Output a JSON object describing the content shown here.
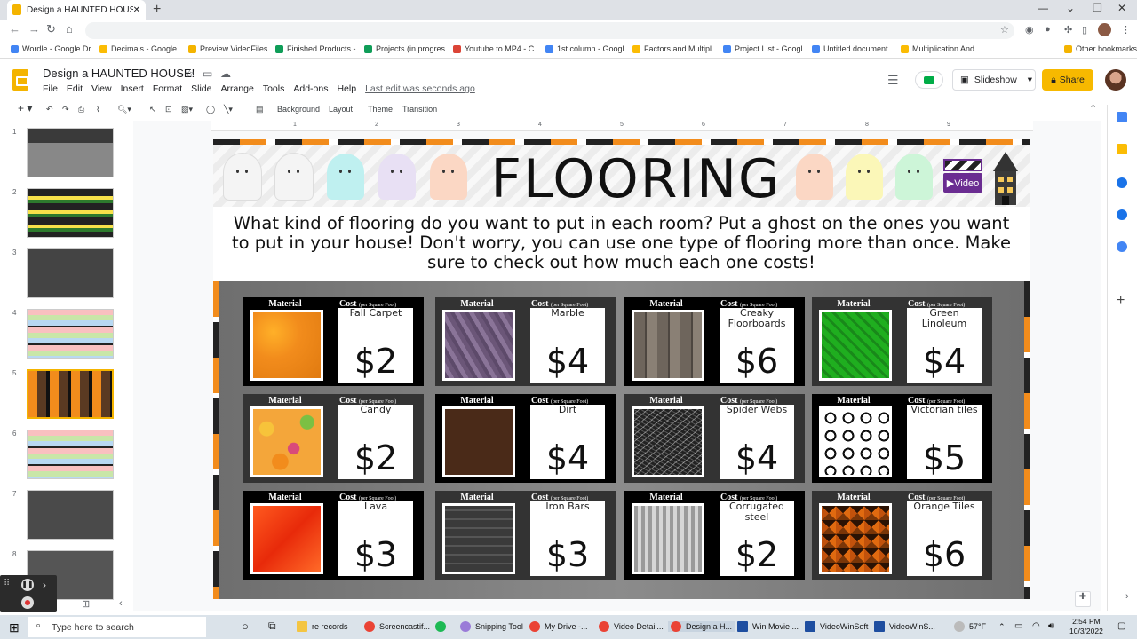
{
  "browser": {
    "tab_title": "Design a HAUNTED HOUSE! - Go",
    "close": "✕",
    "new_tab": "+",
    "bookmarks": [
      "Wordle - Google Dr...",
      "Decimals - Google...",
      "Preview VideoFiles...",
      "Finished Products -...",
      "Projects (in progres...",
      "Youtube to MP4 - C...",
      "1st column - Googl...",
      "Factors and Multipl...",
      "Project List - Googl...",
      "Untitled document...",
      "Multiplication And...",
      "Other bookmarks"
    ]
  },
  "doc": {
    "title": "Design a HAUNTED HOUSE!",
    "menu": [
      "File",
      "Edit",
      "View",
      "Insert",
      "Format",
      "Slide",
      "Arrange",
      "Tools",
      "Add-ons",
      "Help"
    ],
    "last_edit": "Last edit was seconds ago",
    "slideshow": "Slideshow",
    "share": "Share"
  },
  "toolbar": {
    "background": "Background",
    "layout": "Layout",
    "theme": "Theme",
    "transition": "Transition"
  },
  "ruler": [
    "1",
    "2",
    "3",
    "4",
    "5",
    "6",
    "7",
    "8",
    "9"
  ],
  "filmstrip": [
    "1",
    "2",
    "3",
    "4",
    "5",
    "6",
    "7",
    "8"
  ],
  "slide": {
    "title": "FLOORING",
    "video_label": "▶Video",
    "instructions": "What kind of flooring do you want to put in each room? Put a ghost on the ones you want to put in your house! Don't worry, you can use one type of flooring more than once. Make sure to check out how much each one costs!",
    "material_label": "Material",
    "cost_label": "Cost",
    "cost_sub": "(per Square Foot)",
    "cards": [
      {
        "name": "Fall Carpet",
        "price": "$2"
      },
      {
        "name": "Marble",
        "price": "$4"
      },
      {
        "name": "Creaky Floorboards",
        "price": "$6"
      },
      {
        "name": "Green Linoleum",
        "price": "$4"
      },
      {
        "name": "Candy",
        "price": "$2"
      },
      {
        "name": "Dirt",
        "price": "$4"
      },
      {
        "name": "Spider Webs",
        "price": "$4"
      },
      {
        "name": "Victorian tiles",
        "price": "$5"
      },
      {
        "name": "Lava",
        "price": "$3"
      },
      {
        "name": "Iron Bars",
        "price": "$3"
      },
      {
        "name": "Corrugated steel",
        "price": "$2"
      },
      {
        "name": "Orange Tiles",
        "price": "$6"
      }
    ]
  },
  "taskbar": {
    "search_placeholder": "Type here to search",
    "apps": [
      "re records",
      "Screencastif...",
      "Snipping Tool",
      "My Drive -...",
      "Video Detail...",
      "Design a H...",
      "Win Movie ...",
      "VideoWinSoft",
      "VideoWinS..."
    ],
    "weather": "57°F",
    "time": "2:54 PM",
    "date": "10/3/2022"
  }
}
